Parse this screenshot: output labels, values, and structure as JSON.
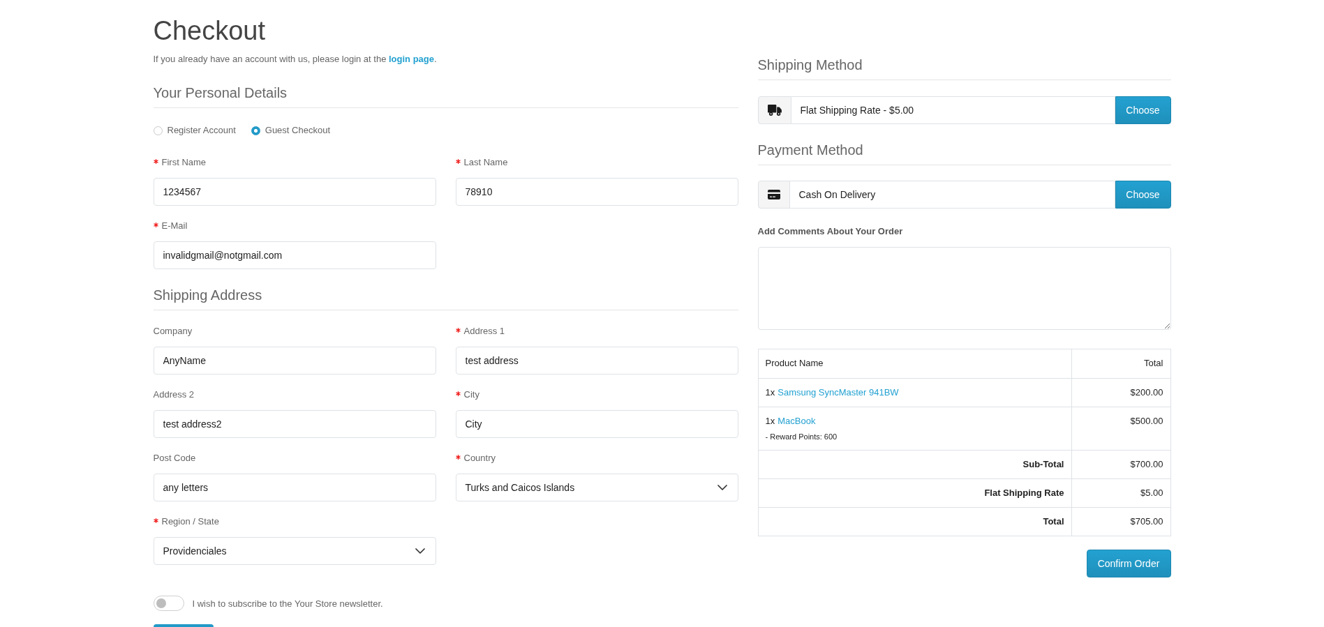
{
  "header": {
    "title": "Checkout",
    "login_note": {
      "before": "If you already have an account with us, please login at the ",
      "link": "login page",
      "after": "."
    }
  },
  "personal_details": {
    "heading": "Your Personal Details",
    "account_options": [
      {
        "label": "Register Account",
        "selected": false
      },
      {
        "label": "Guest Checkout",
        "selected": true
      }
    ],
    "fields": [
      {
        "kind": "text",
        "label": "First Name",
        "required": true,
        "value": "1234567"
      },
      {
        "kind": "text",
        "label": "Last Name",
        "required": true,
        "value": "78910"
      },
      {
        "kind": "text",
        "label": "E-Mail",
        "required": true,
        "value": "invalidgmail@notgmail.com"
      }
    ]
  },
  "shipping_address": {
    "heading": "Shipping Address",
    "fields": [
      {
        "kind": "text",
        "label": "Company",
        "required": false,
        "value": "AnyName"
      },
      {
        "kind": "text",
        "label": "Address 1",
        "required": true,
        "value": "test address"
      },
      {
        "kind": "text",
        "label": "Address 2",
        "required": false,
        "value": "test address2"
      },
      {
        "kind": "text",
        "label": "City",
        "required": true,
        "value": "City"
      },
      {
        "kind": "text",
        "label": "Post Code",
        "required": false,
        "value": "any letters"
      },
      {
        "kind": "select",
        "label": "Country",
        "required": true,
        "value": "Turks and Caicos Islands"
      },
      {
        "kind": "select",
        "label": "Region / State",
        "required": true,
        "value": "Providenciales"
      }
    ]
  },
  "newsletter": {
    "label": "I wish to subscribe to the Your Store newsletter.",
    "on": false
  },
  "shipping_method": {
    "heading": "Shipping Method",
    "value": "Flat Shipping Rate - $5.00",
    "button": "Choose"
  },
  "payment_method": {
    "heading": "Payment Method",
    "value": "Cash On Delivery",
    "button": "Choose"
  },
  "comments": {
    "label": "Add Comments About Your Order"
  },
  "order_table": {
    "columns": [
      "Product Name",
      "Total"
    ],
    "items": [
      {
        "quantity": "1x",
        "name": "Samsung SyncMaster 941BW",
        "total": "$200.00"
      },
      {
        "quantity": "1x",
        "name": "MacBook",
        "reward": "- Reward Points: 600",
        "total": "$500.00"
      }
    ],
    "totals": [
      {
        "label": "Sub-Total",
        "value": "$700.00"
      },
      {
        "label": "Flat Shipping Rate",
        "value": "$5.00"
      },
      {
        "label": "Total",
        "value": "$705.00"
      }
    ]
  },
  "confirm_button": "Confirm Order"
}
